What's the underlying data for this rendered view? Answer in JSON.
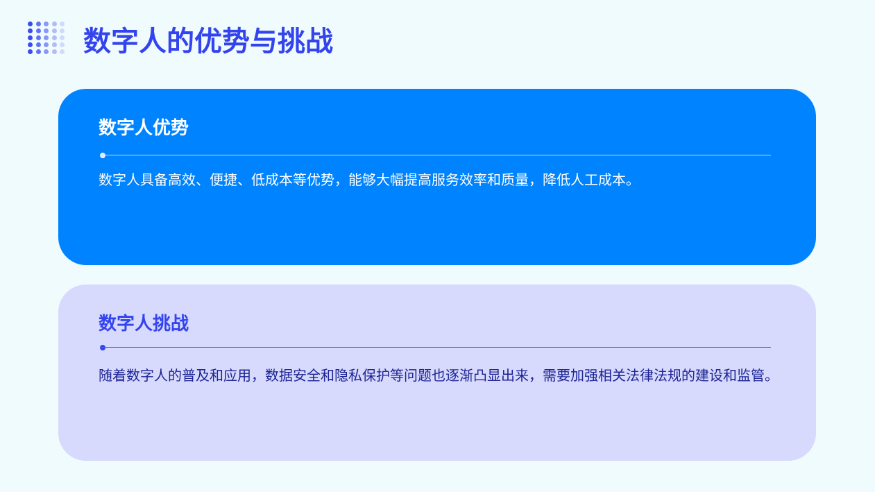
{
  "header": {
    "title": "数字人的优势与挑战",
    "decoration_icon": "dot-grid-icon"
  },
  "cards": [
    {
      "title": "数字人优势",
      "body": "数字人具备高效、便捷、低成本等优势，能够大幅提高服务效率和质量，降低人工成本。",
      "background": "#0083FE"
    },
    {
      "title": "数字人挑战",
      "body": "随着数字人的普及和应用，数据安全和隐私保护等问题也逐渐凸显出来，需要加强相关法律法规的建设和监管。",
      "background": "#D7D9FD"
    }
  ],
  "colors": {
    "page_background": "#F0FBFE",
    "accent": "#3344EE"
  }
}
